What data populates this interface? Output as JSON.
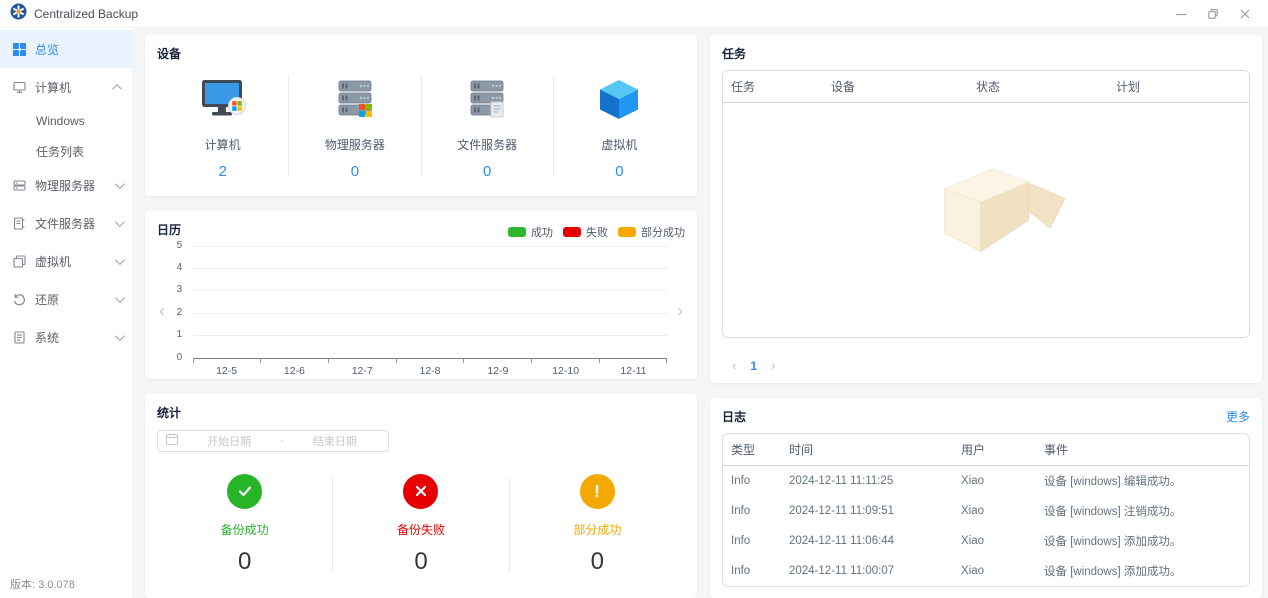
{
  "window": {
    "title": "Centralized Backup"
  },
  "sidebar": {
    "items": [
      {
        "label": "总览",
        "selected": true
      },
      {
        "label": "计算机",
        "expanded": true,
        "children": [
          "Windows",
          "任务列表"
        ]
      },
      {
        "label": "物理服务器"
      },
      {
        "label": "文件服务器"
      },
      {
        "label": "虚拟机"
      },
      {
        "label": "还原"
      },
      {
        "label": "系统"
      }
    ],
    "version": "版本: 3.0.078"
  },
  "devices": {
    "title": "设备",
    "items": [
      {
        "label": "计算机",
        "count": "2",
        "icon": "computer-icon"
      },
      {
        "label": "物理服务器",
        "count": "0",
        "icon": "physical-server-icon"
      },
      {
        "label": "文件服务器",
        "count": "0",
        "icon": "file-server-icon"
      },
      {
        "label": "虚拟机",
        "count": "0",
        "icon": "vm-cube-icon"
      }
    ],
    "accent_color": "#2d8cf0"
  },
  "calendar": {
    "title": "日历",
    "legend": [
      {
        "label": "成功",
        "color": "#2eb82e"
      },
      {
        "label": "失败",
        "color": "#e60000"
      },
      {
        "label": "部分成功",
        "color": "#f5a800"
      }
    ],
    "y_ticks": [
      "5",
      "4",
      "3",
      "2",
      "1",
      "0"
    ],
    "x_labels": [
      "12-5",
      "12-6",
      "12-7",
      "12-8",
      "12-9",
      "12-10",
      "12-11"
    ],
    "series": []
  },
  "tasks": {
    "title": "任务",
    "columns": [
      "任务",
      "设备",
      "状态",
      "计划"
    ],
    "rows": [],
    "pagination": {
      "current": "1"
    }
  },
  "stats": {
    "title": "统计",
    "date_range": {
      "start_placeholder": "开始日期",
      "separator": "-",
      "end_placeholder": "结束日期"
    },
    "items": [
      {
        "label": "备份成功",
        "value": "0",
        "color": "#27b427",
        "icon": "check-circle-icon"
      },
      {
        "label": "备份失败",
        "value": "0",
        "color": "#e60000",
        "icon": "x-circle-icon"
      },
      {
        "label": "部分成功",
        "value": "0",
        "color": "#f5a800",
        "icon": "exclamation-circle-icon"
      }
    ]
  },
  "logs": {
    "title": "日志",
    "more_label": "更多",
    "columns": [
      "类型",
      "时间",
      "用户",
      "事件"
    ],
    "rows": [
      [
        "Info",
        "2024-12-11 11:11:25",
        "Xiao",
        "设备 [windows] 编辑成功。"
      ],
      [
        "Info",
        "2024-12-11 11:09:51",
        "Xiao",
        "设备 [windows] 注销成功。"
      ],
      [
        "Info",
        "2024-12-11 11:06:44",
        "Xiao",
        "设备 [windows] 添加成功。"
      ],
      [
        "Info",
        "2024-12-11 11:00:07",
        "Xiao",
        "设备 [windows] 添加成功。"
      ]
    ]
  },
  "icons": {
    "chevron_left": "‹",
    "chevron_right": "›"
  }
}
